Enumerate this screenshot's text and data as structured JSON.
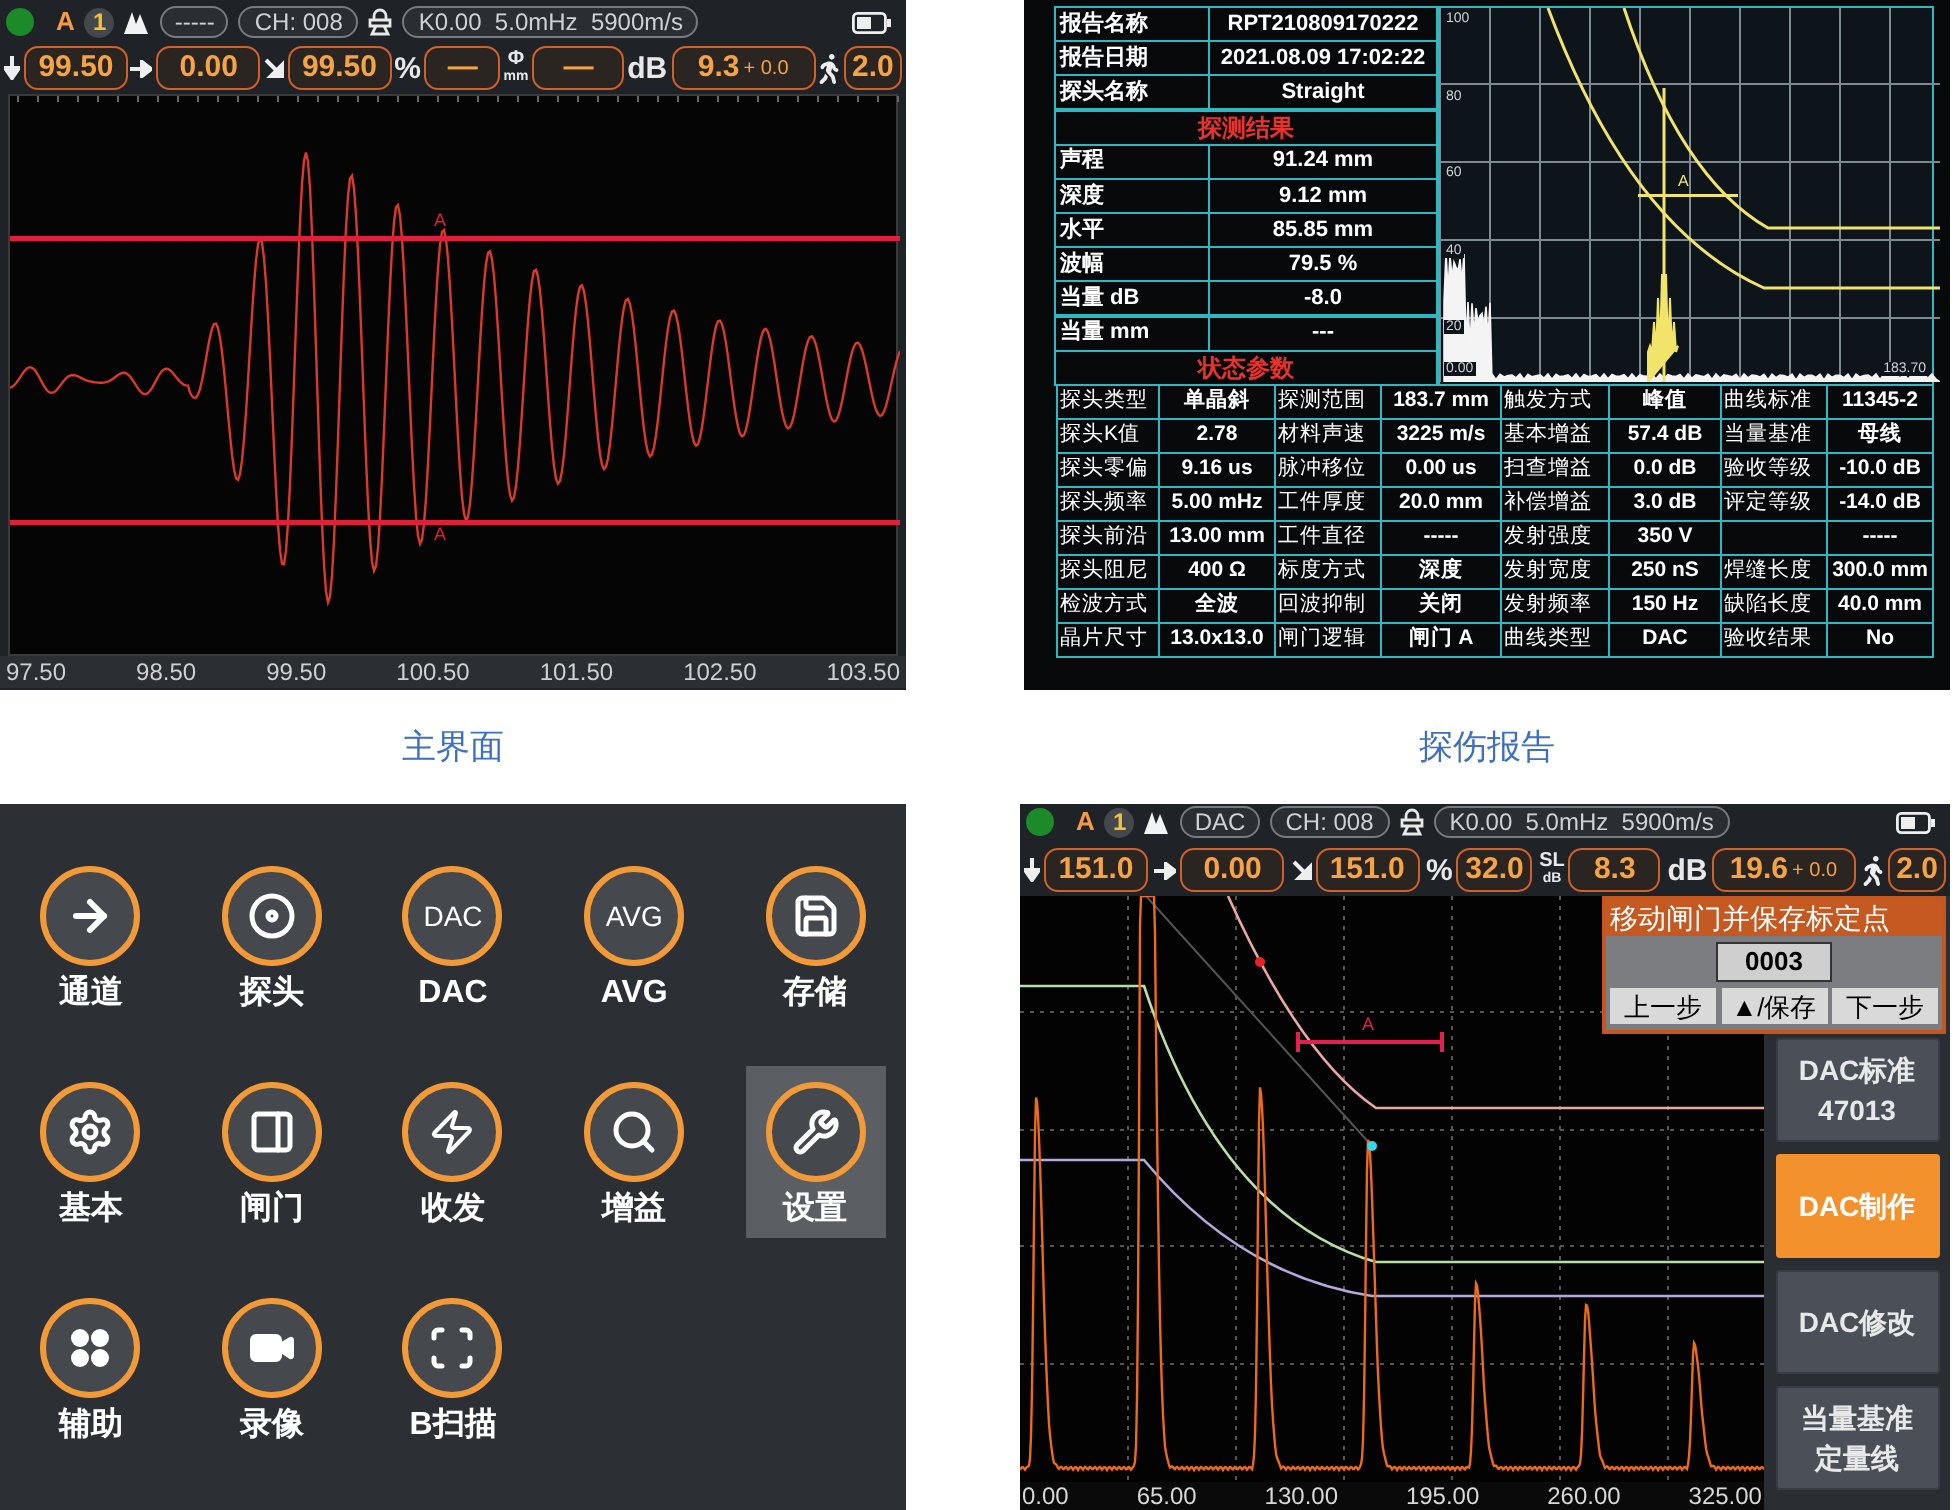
{
  "main_screen": {
    "status_bar": {
      "mode": "A",
      "gate_number": "1",
      "curve_tag": "-----",
      "channel": "CH: 008",
      "probe": "K0.00  5.0mHz  5900m/s"
    },
    "readings": [
      {
        "kind": "depth",
        "value": "99.50"
      },
      {
        "kind": "offset",
        "value": "0.00"
      },
      {
        "kind": "path",
        "value": "99.50"
      },
      {
        "kind": "unit",
        "unit": "%",
        "value": "—"
      },
      {
        "kind": "stacked_unit",
        "unit": "Φ",
        "subunit": "mm",
        "value": "—"
      },
      {
        "kind": "gain",
        "unit": "dB",
        "value": "9.3",
        "offset": "+ 0.0"
      },
      {
        "kind": "walker",
        "value": "2.0"
      }
    ],
    "gate_labels": [
      "A",
      "A"
    ],
    "x_labels": [
      "97.50",
      "98.50",
      "99.50",
      "100.50",
      "101.50",
      "102.50",
      "103.50"
    ],
    "caption": "主界面"
  },
  "report": {
    "header_rows": [
      {
        "label": "报告名称",
        "value": "RPT210809170222"
      },
      {
        "label": "报告日期",
        "value": "2021.08.09  17:02:22"
      },
      {
        "label": "探头名称",
        "value": "Straight"
      }
    ],
    "result_title": "探测结果",
    "result_rows": [
      {
        "label": "声程",
        "value": "91.24 mm"
      },
      {
        "label": "深度",
        "value": "9.12 mm"
      },
      {
        "label": "水平",
        "value": "85.85 mm"
      },
      {
        "label": "波幅",
        "value": "79.5 %"
      },
      {
        "label": "当量 dB",
        "value": "-8.0"
      },
      {
        "label": "当量 mm",
        "value": "---"
      }
    ],
    "chart": {
      "y_labels": [
        "100",
        "80",
        "60",
        "40",
        "20"
      ],
      "x_labels": [
        "0.00",
        "183.70"
      ],
      "gate_label": "A"
    },
    "status_title": "状态参数",
    "status_rows": [
      [
        {
          "label": "探头类型",
          "value": "单晶斜"
        },
        {
          "label": "探测范围",
          "value": "183.7 mm"
        },
        {
          "label": "触发方式",
          "value": "峰值"
        },
        {
          "label": "曲线标准",
          "value": "11345-2"
        }
      ],
      [
        {
          "label": "探头K值",
          "value": "2.78"
        },
        {
          "label": "材料声速",
          "value": "3225 m/s"
        },
        {
          "label": "基本增益",
          "value": "57.4 dB"
        },
        {
          "label": "当量基准",
          "value": "母线"
        }
      ],
      [
        {
          "label": "探头零偏",
          "value": "9.16 us"
        },
        {
          "label": "脉冲移位",
          "value": "0.00 us"
        },
        {
          "label": "扫查增益",
          "value": "0.0 dB"
        },
        {
          "label": "验收等级",
          "value": "-10.0 dB"
        }
      ],
      [
        {
          "label": "探头频率",
          "value": "5.00 mHz"
        },
        {
          "label": "工件厚度",
          "value": "20.0 mm"
        },
        {
          "label": "补偿增益",
          "value": "3.0 dB"
        },
        {
          "label": "评定等级",
          "value": "-14.0 dB"
        }
      ],
      [
        {
          "label": "探头前沿",
          "value": "13.00 mm"
        },
        {
          "label": "工件直径",
          "value": "-----"
        },
        {
          "label": "发射强度",
          "value": "350 V"
        },
        {
          "value": "-----"
        }
      ],
      [
        {
          "label": "探头阻尼",
          "value": "400 Ω"
        },
        {
          "label": "标度方式",
          "value": "深度"
        },
        {
          "label": "发射宽度",
          "value": "250 nS"
        },
        {
          "label": "焊缝长度",
          "value": "300.0 mm"
        }
      ],
      [
        {
          "label": "检波方式",
          "value": "全波"
        },
        {
          "label": "回波抑制",
          "value": "关闭"
        },
        {
          "label": "发射频率",
          "value": "150 Hz"
        },
        {
          "label": "缺陷长度",
          "value": "40.0 mm"
        }
      ],
      [
        {
          "label": "晶片尺寸",
          "value": "13.0x13.0"
        },
        {
          "label": "闸门逻辑",
          "value": "闸门 A"
        },
        {
          "label": "曲线类型",
          "value": "DAC"
        },
        {
          "label": "验收结果",
          "value": "No"
        }
      ]
    ],
    "caption": "探伤报告"
  },
  "menu": {
    "items": [
      {
        "label": "通道",
        "kind": "arrow",
        "selected": false
      },
      {
        "label": "探头",
        "kind": "disc",
        "selected": false
      },
      {
        "label": "DAC",
        "kind": "text",
        "icon_text": "DAC",
        "selected": false
      },
      {
        "label": "AVG",
        "kind": "text",
        "icon_text": "AVG",
        "selected": false
      },
      {
        "label": "存储",
        "kind": "save",
        "selected": false
      },
      {
        "label": "基本",
        "kind": "gear",
        "selected": false
      },
      {
        "label": "闸门",
        "kind": "panel",
        "selected": false
      },
      {
        "label": "收发",
        "kind": "bolt",
        "selected": false
      },
      {
        "label": "增益",
        "kind": "search",
        "selected": false
      },
      {
        "label": "设置",
        "kind": "tools",
        "selected": true
      },
      {
        "label": "辅助",
        "kind": "dots",
        "selected": false
      },
      {
        "label": "录像",
        "kind": "video",
        "selected": false
      },
      {
        "label": "B扫描",
        "kind": "scan",
        "selected": false
      }
    ]
  },
  "dac_screen": {
    "status_bar": {
      "mode": "A",
      "gate_number": "1",
      "curve_tag": "DAC",
      "channel": "CH: 008",
      "probe": "K0.00  5.0mHz  5900m/s"
    },
    "readings": [
      {
        "kind": "depth",
        "value": "151.0"
      },
      {
        "kind": "offset",
        "value": "0.00"
      },
      {
        "kind": "path",
        "value": "151.0"
      },
      {
        "kind": "unit",
        "unit": "%",
        "value": "32.0"
      },
      {
        "kind": "stacked_unit",
        "unit": "SL",
        "subunit": "dB",
        "value": "8.3"
      },
      {
        "kind": "gain",
        "unit": "dB",
        "value": "19.6",
        "offset": "+ 0.0"
      },
      {
        "kind": "walker",
        "value": "2.0"
      }
    ],
    "gate_label": "A",
    "x_labels": [
      "0.00",
      "65.00",
      "130.00",
      "195.00",
      "260.00",
      "325.00"
    ],
    "popup": {
      "title": "移动闸门并保存标定点",
      "value": "0003",
      "buttons": [
        "上一步",
        "▲/保存",
        "下一步"
      ]
    },
    "side_buttons": [
      {
        "label": "DAC标准",
        "sublabel": "47013",
        "selected": false
      },
      {
        "label": "DAC制作",
        "selected": true
      },
      {
        "label": "DAC修改",
        "selected": false
      },
      {
        "label": "当量基准",
        "sublabel": "定量线",
        "selected": false
      }
    ]
  }
}
